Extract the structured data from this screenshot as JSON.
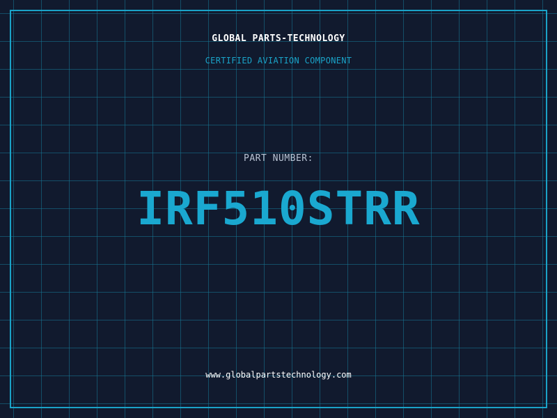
{
  "header": {
    "company": "GLOBAL PARTS-TECHNOLOGY",
    "tagline": "CERTIFIED AVIATION COMPONENT"
  },
  "main": {
    "label": "PART NUMBER:",
    "part_number": "IRF510STRR"
  },
  "footer": {
    "website": "www.globalpartstechnology.com"
  },
  "colors": {
    "background": "#111a2e",
    "grid": "#16789a",
    "accent": "#1aa3c8",
    "text": "#ffffff",
    "label": "#b9c4d4"
  }
}
